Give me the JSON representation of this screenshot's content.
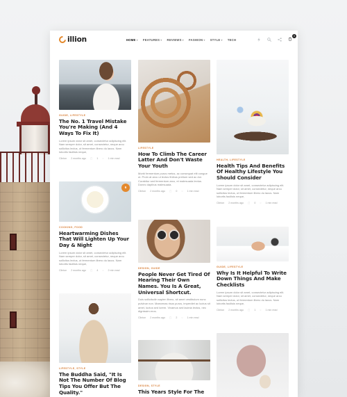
{
  "site": {
    "logo_text": "illion"
  },
  "nav": {
    "items": [
      {
        "label": "HOME",
        "suffix": "▾",
        "active": true
      },
      {
        "label": "FEATURES",
        "suffix": "▾"
      },
      {
        "label": "REVIEWS",
        "suffix": "▾"
      },
      {
        "label": "FASHION",
        "suffix": "▾"
      },
      {
        "label": "STYLE",
        "suffix": "▾"
      },
      {
        "label": "TECH",
        "suffix": ""
      }
    ],
    "cart_count": "0",
    "icons": [
      "bolt-icon",
      "search-icon",
      "share-icon",
      "cart-icon"
    ]
  },
  "colors": {
    "accent": "#e4892d",
    "category": "#d9803a",
    "title": "#1f1f1f",
    "text": "#8a8a8a"
  },
  "columns": [
    {
      "posts": [
        {
          "category": "GUIDE, LIFESTYLE",
          "title": "The No. 1 Travel Mistake You're Making (And 4 Ways To Fix It)",
          "excerpt": "Lorem ipsum dolor sit amet, consectetur adipiscing elit. Nam semper dolor, sit amet, consectetur, neque arcu sollicitus lectus, ut fermentum libero du lacus. Nam lobortis facilisis neque,",
          "author": "Clinton",
          "date": "2 months ago",
          "comments": "1",
          "read_time": "1 min read"
        },
        {
          "badge": "6",
          "category": "COOKING, FOOD",
          "title": "Heartwarming Dishes That Will Lighten Up Your Day & Night",
          "excerpt": "Lorem ipsum dolor sit amet, consectetur adipiscing elit. Nam semper dolor, sit amet, consectetur, neque arcu sollicitus lectus, ut fermentum libero du lacus. Nam lobortis facilisis neque,",
          "author": "Clinton",
          "date": "2 months ago",
          "comments": "4",
          "read_time": "2 min read"
        },
        {
          "category": "LIFESTYLE, STYLE",
          "title": "The Buddha Said, \"It Is Not The Number Of Blog Tips You Offer But The Quality.\"",
          "excerpt": "",
          "author": "",
          "date": "",
          "comments": "",
          "read_time": ""
        }
      ]
    },
    {
      "posts": [
        {
          "category": "LIFESTYLE",
          "title": "How To Climb The Career Latter And Don't Waste Your Youth",
          "excerpt": "Morbi fermentum purus metus, ac consequat elit congue ut. Proin at arcu ut lectus finibus pretium sed ac dui. Curabitur sed fermentum arcu, et malesuada lectus. Donec dapibus malesuada.",
          "author": "Clinton",
          "date": "2 months ago",
          "comments": "0",
          "read_time": "1 min read"
        },
        {
          "category": "DESIGN, GUIDE",
          "title": "People Never Get Tired Of Hearing Their Own Names. You Is A Great, Universal Shortcut.",
          "excerpt": "Duis sollicitudin sapien libero, sit amet vestibulum nunc pulvinar non. Maecenas risus purus, imperdiet ac luctus sit amet, luctus sed lorem. Vivamus sed lacinia lectus, nec dignissim eros.",
          "author": "Clinton",
          "date": "2 months ago",
          "comments": "2",
          "read_time": "1 min read"
        },
        {
          "category": "DESIGN, STYLE",
          "title": "This Years Style For The",
          "excerpt": "",
          "author": "",
          "date": "",
          "comments": "",
          "read_time": ""
        }
      ]
    },
    {
      "posts": [
        {
          "category": "HEALTH, LIFESTYLE",
          "title": "Health Tips And Benefits Of Healthy Lifestyle You Should Consider",
          "excerpt": "Lorem ipsum dolor sit amet, consectetur adipiscing elit. Nam semper dolor, sit amet, consectetur, neque arcu sollicitus lectus, ut fermentum libero du lacus. Nam lobortis facilisis neque,",
          "author": "Clinton",
          "date": "2 months ago",
          "comments": "0",
          "read_time": "1 min read"
        },
        {
          "category": "GUIDE, LIFESTYLE",
          "title": "Why Is It Helpful To Write Down Things And Make Checklists",
          "excerpt": "Lorem ipsum dolor sit amet, consectetur adipiscing elit. Nam semper dolor, sit amet, consectetur, neque arcu sollicitus lectus, ut fermentum libero du lacus. Nam lobortis facilisis neque,",
          "author": "Clinton",
          "date": "2 months ago",
          "comments": "1",
          "read_time": "1 min read"
        },
        {
          "category": "",
          "title": "",
          "excerpt": "",
          "author": "",
          "date": "",
          "comments": "",
          "read_time": ""
        }
      ]
    }
  ]
}
